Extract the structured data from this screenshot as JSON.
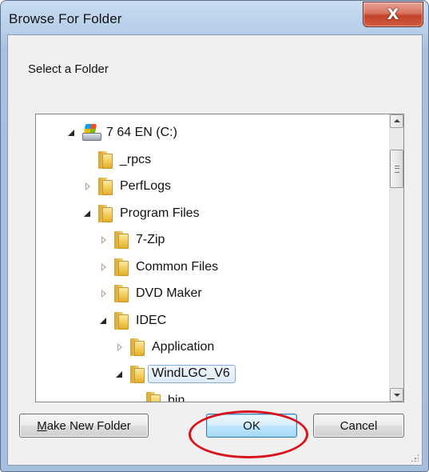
{
  "window": {
    "title": "Browse For Folder",
    "close_glyph": "X"
  },
  "dialog": {
    "instruction": "Select a Folder"
  },
  "tree": {
    "items": [
      {
        "label": "7 64 EN (C:)",
        "icon": "drive-icon",
        "expander": "expanded",
        "depth": 0
      },
      {
        "label": "_rpcs",
        "icon": "folder-icon",
        "expander": "none",
        "depth": 1
      },
      {
        "label": "PerfLogs",
        "icon": "folder-icon",
        "expander": "collapsed",
        "depth": 1
      },
      {
        "label": "Program Files",
        "icon": "folder-icon",
        "expander": "expanded",
        "depth": 1
      },
      {
        "label": "7-Zip",
        "icon": "folder-icon",
        "expander": "collapsed",
        "depth": 2
      },
      {
        "label": "Common Files",
        "icon": "folder-icon",
        "expander": "collapsed",
        "depth": 2
      },
      {
        "label": "DVD Maker",
        "icon": "folder-icon",
        "expander": "collapsed",
        "depth": 2
      },
      {
        "label": "IDEC",
        "icon": "folder-icon",
        "expander": "expanded",
        "depth": 2
      },
      {
        "label": "Application",
        "icon": "folder-icon",
        "expander": "collapsed",
        "depth": 3
      },
      {
        "label": "WindLGC_V6",
        "icon": "folder-icon",
        "expander": "expanded",
        "depth": 3,
        "selected": true
      },
      {
        "label": "bin",
        "icon": "folder-icon",
        "expander": "none",
        "depth": 4
      }
    ]
  },
  "buttons": {
    "make_new_folder_accel": "M",
    "make_new_folder_rest": "ake New Folder",
    "ok": "OK",
    "cancel": "Cancel"
  },
  "colors": {
    "highlight_ellipse": "#d9131b",
    "selection_border": "#84acdd",
    "default_button_border": "#3c7fb1"
  }
}
